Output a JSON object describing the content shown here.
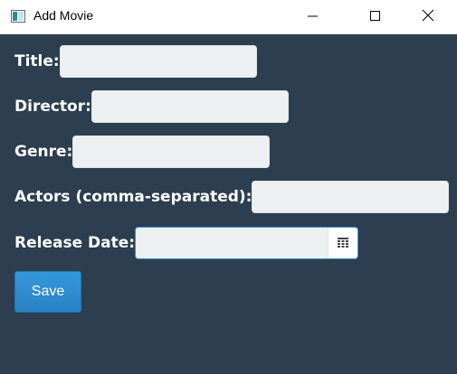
{
  "window": {
    "title": "Add Movie"
  },
  "form": {
    "title_label": "Title:",
    "title_value": "",
    "director_label": "Director:",
    "director_value": "",
    "genre_label": "Genre:",
    "genre_value": "",
    "actors_label": "Actors (comma-separated):",
    "actors_value": "",
    "release_date_label": "Release Date:",
    "release_date_value": ""
  },
  "buttons": {
    "save_label": "Save"
  },
  "icons": {
    "app": "app-window-icon",
    "minimize": "minimize-icon",
    "maximize": "maximize-icon",
    "close": "close-icon",
    "calendar": "calendar-icon"
  },
  "colors": {
    "background": "#2c3e50",
    "field": "#ecf0f1",
    "accent": "#3498db",
    "label": "#ffffff"
  }
}
